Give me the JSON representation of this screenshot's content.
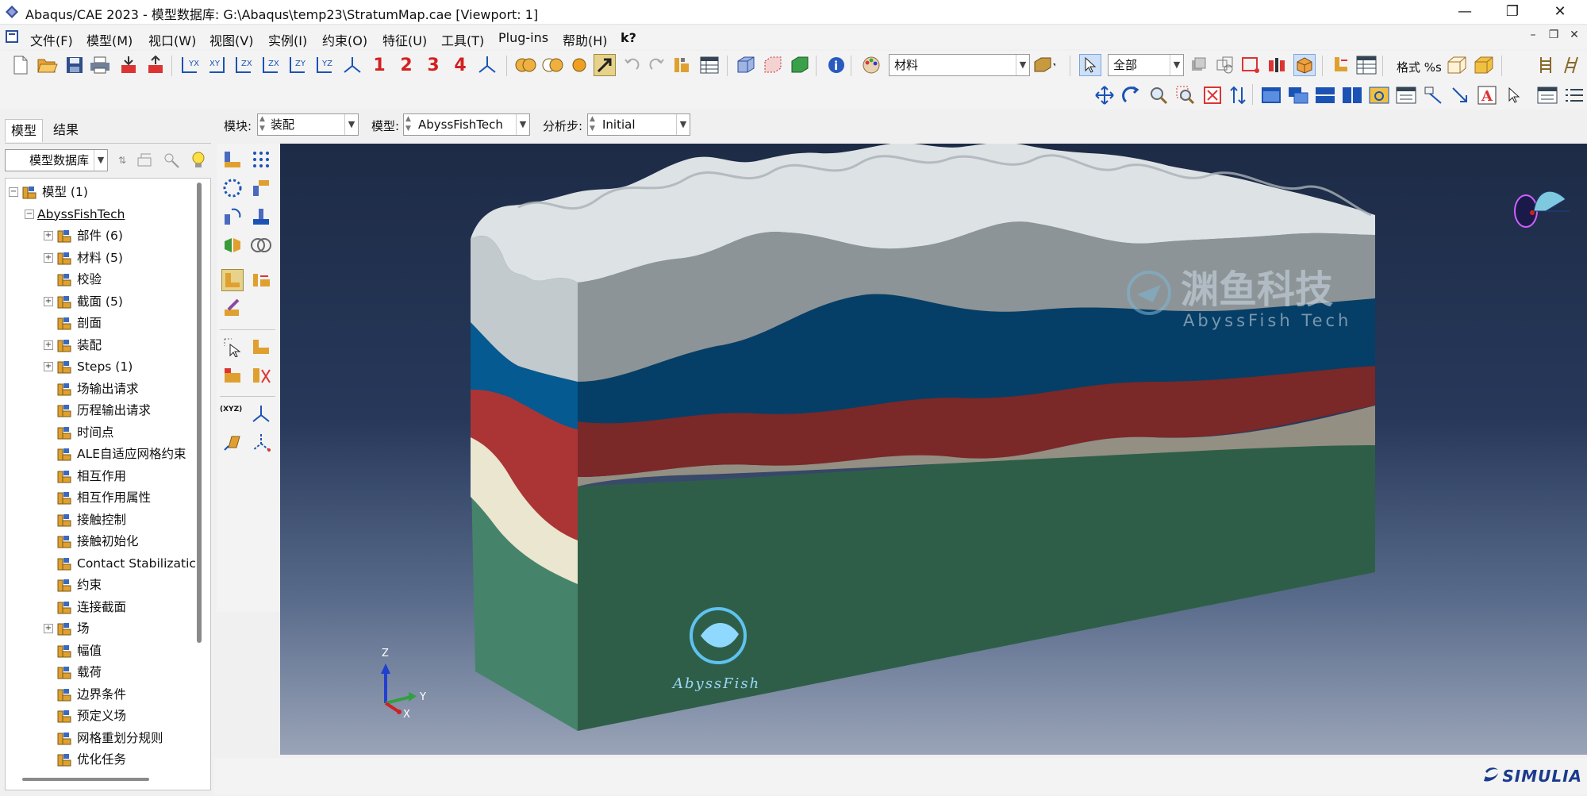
{
  "window": {
    "title": "Abaqus/CAE 2023 - 模型数据库: G:\\Abaqus\\temp23\\StratumMap.cae [Viewport: 1]",
    "controls": [
      "—",
      "❐",
      "✕"
    ]
  },
  "menu": {
    "items": [
      "文件(F)",
      "模型(M)",
      "视口(W)",
      "视图(V)",
      "实例(I)",
      "约束(O)",
      "特征(U)",
      "工具(T)",
      "Plug-ins",
      "帮助(H)",
      "k?"
    ],
    "mdi_controls": [
      "–",
      "❐",
      "✕"
    ]
  },
  "toolbar": {
    "numbers": [
      "1",
      "2",
      "3",
      "4"
    ],
    "material_combo": "材料",
    "selection_combo": "全部",
    "format_label": "格式 %s"
  },
  "left_panel": {
    "tabs": [
      "模型",
      "结果"
    ],
    "database_combo": "模型数据库",
    "tree": [
      {
        "label": "模型 (1)",
        "level": 0,
        "expander": "−",
        "icon": "models-icon"
      },
      {
        "label": "AbyssFishTech",
        "level": 1,
        "expander": "−",
        "icon": ""
      },
      {
        "label": "部件 (6)",
        "level": 2,
        "expander": "+",
        "icon": "parts-icon"
      },
      {
        "label": "材料 (5)",
        "level": 2,
        "expander": "+",
        "icon": "materials-icon"
      },
      {
        "label": "校验",
        "level": 2,
        "expander": "",
        "icon": "calibration-icon"
      },
      {
        "label": "截面 (5)",
        "level": 2,
        "expander": "+",
        "icon": "sections-icon"
      },
      {
        "label": "剖面",
        "level": 2,
        "expander": "",
        "icon": "profiles-icon"
      },
      {
        "label": "装配",
        "level": 2,
        "expander": "+",
        "icon": "assembly-icon"
      },
      {
        "label": "Steps (1)",
        "level": 2,
        "expander": "+",
        "icon": "steps-icon"
      },
      {
        "label": "场输出请求",
        "level": 2,
        "expander": "",
        "icon": "field-output-icon"
      },
      {
        "label": "历程输出请求",
        "level": 2,
        "expander": "",
        "icon": "history-output-icon"
      },
      {
        "label": "时间点",
        "level": 2,
        "expander": "",
        "icon": "time-points-icon"
      },
      {
        "label": "ALE自适应网格约束",
        "level": 2,
        "expander": "",
        "icon": "ale-icon"
      },
      {
        "label": "相互作用",
        "level": 2,
        "expander": "",
        "icon": "interactions-icon"
      },
      {
        "label": "相互作用属性",
        "level": 2,
        "expander": "",
        "icon": "interaction-props-icon"
      },
      {
        "label": "接触控制",
        "level": 2,
        "expander": "",
        "icon": "contact-controls-icon"
      },
      {
        "label": "接触初始化",
        "level": 2,
        "expander": "",
        "icon": "contact-init-icon"
      },
      {
        "label": "Contact Stabilizatic",
        "level": 2,
        "expander": "",
        "icon": "contact-stab-icon"
      },
      {
        "label": "约束",
        "level": 2,
        "expander": "",
        "icon": "constraints-icon"
      },
      {
        "label": "连接截面",
        "level": 2,
        "expander": "",
        "icon": "connector-sections-icon"
      },
      {
        "label": "场",
        "level": 2,
        "expander": "+",
        "icon": "fields-icon"
      },
      {
        "label": "幅值",
        "level": 2,
        "expander": "",
        "icon": "amplitudes-icon"
      },
      {
        "label": "载荷",
        "level": 2,
        "expander": "",
        "icon": "loads-icon"
      },
      {
        "label": "边界条件",
        "level": 2,
        "expander": "",
        "icon": "bcs-icon"
      },
      {
        "label": "预定义场",
        "level": 2,
        "expander": "",
        "icon": "predefined-fields-icon"
      },
      {
        "label": "网格重划分规则",
        "level": 2,
        "expander": "",
        "icon": "remeshing-icon"
      },
      {
        "label": "优化任务",
        "level": 2,
        "expander": "",
        "icon": "optimization-icon"
      }
    ]
  },
  "context_bar": {
    "module_label": "模块:",
    "module_value": "装配",
    "model_label": "模型:",
    "model_value": "AbyssFishTech",
    "step_label": "分析步:",
    "step_value": "Initial"
  },
  "viewport": {
    "watermark_cn": "渊鱼科技",
    "watermark_en": "AbyssFish Tech",
    "logo_text": "AbyssFish",
    "triad": {
      "z": "Z",
      "y": "Y",
      "x": "X"
    },
    "layer_colors": [
      "#c3cacd",
      "#045a91",
      "#ab3535",
      "#ebe6cf",
      "#3f8066"
    ]
  },
  "status": {
    "brand": "SIMULIA"
  }
}
